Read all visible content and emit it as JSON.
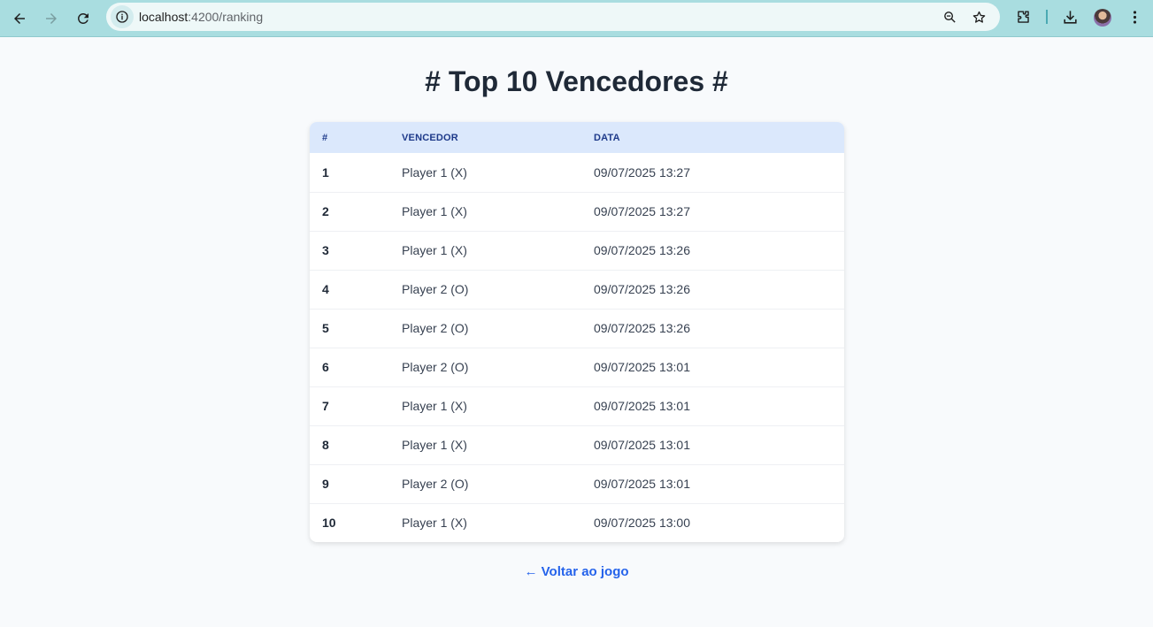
{
  "browser": {
    "url_host": "localhost",
    "url_path": ":4200/ranking",
    "accent_color": "#a9dde0"
  },
  "page": {
    "title": "# Top 10 Vencedores #",
    "back_link": "← Voltar ao jogo"
  },
  "table": {
    "headers": [
      "#",
      "VENCEDOR",
      "DATA"
    ],
    "rows": [
      {
        "rank": "1",
        "winner": "Player 1 (X)",
        "date": "09/07/2025 13:27"
      },
      {
        "rank": "2",
        "winner": "Player 1 (X)",
        "date": "09/07/2025 13:27"
      },
      {
        "rank": "3",
        "winner": "Player 1 (X)",
        "date": "09/07/2025 13:26"
      },
      {
        "rank": "4",
        "winner": "Player 2 (O)",
        "date": "09/07/2025 13:26"
      },
      {
        "rank": "5",
        "winner": "Player 2 (O)",
        "date": "09/07/2025 13:26"
      },
      {
        "rank": "6",
        "winner": "Player 2 (O)",
        "date": "09/07/2025 13:01"
      },
      {
        "rank": "7",
        "winner": "Player 1 (X)",
        "date": "09/07/2025 13:01"
      },
      {
        "rank": "8",
        "winner": "Player 1 (X)",
        "date": "09/07/2025 13:01"
      },
      {
        "rank": "9",
        "winner": "Player 2 (O)",
        "date": "09/07/2025 13:01"
      },
      {
        "rank": "10",
        "winner": "Player 1 (X)",
        "date": "09/07/2025 13:00"
      }
    ]
  }
}
